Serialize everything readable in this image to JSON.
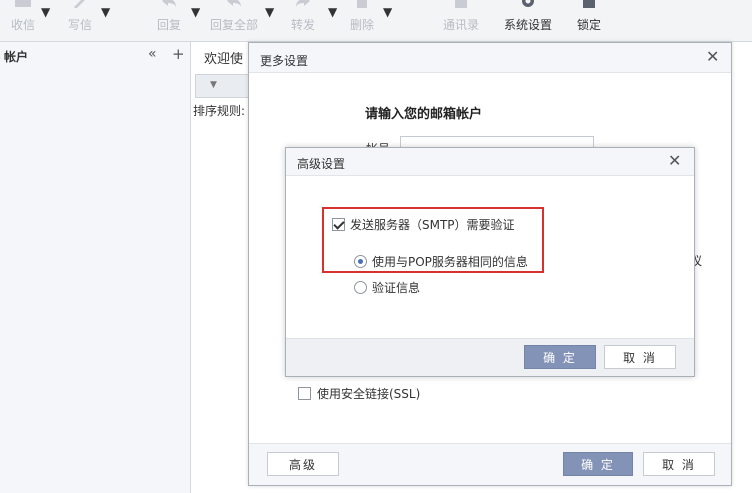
{
  "toolbar": {
    "receive": "收信",
    "compose": "写信",
    "reply": "回复",
    "reply_all": "回复全部",
    "forward": "转发",
    "delete": "删除",
    "contacts": "通讯录",
    "settings": "系统设置",
    "lock": "锁定"
  },
  "sidebar": {
    "title": "帐户",
    "collapse": "«",
    "add": "+"
  },
  "main": {
    "welcome_tab": "欢迎使",
    "sort_label": "排序规则:"
  },
  "more_settings": {
    "title": "更多设置",
    "subtitle": "请输入您的邮箱帐户",
    "account_label": "帐号",
    "account_value": "",
    "side_char": "议",
    "ssl_label": "使用安全链接(SSL)",
    "ssl_checked": false,
    "advanced_button": "高级",
    "ok_button": "确 定",
    "cancel_button": "取 消"
  },
  "advanced_settings": {
    "title": "高级设置",
    "smtp_auth_label": "发送服务器（SMTP）需要验证",
    "smtp_auth_checked": true,
    "option_same_pop": "使用与POP服务器相同的信息",
    "option_verify_info": "验证信息",
    "selected_option": "option_same_pop",
    "ok_button": "确 定",
    "cancel_button": "取 消"
  },
  "colors": {
    "primary_button": "#8393b7",
    "highlight_border": "#d9302e"
  }
}
